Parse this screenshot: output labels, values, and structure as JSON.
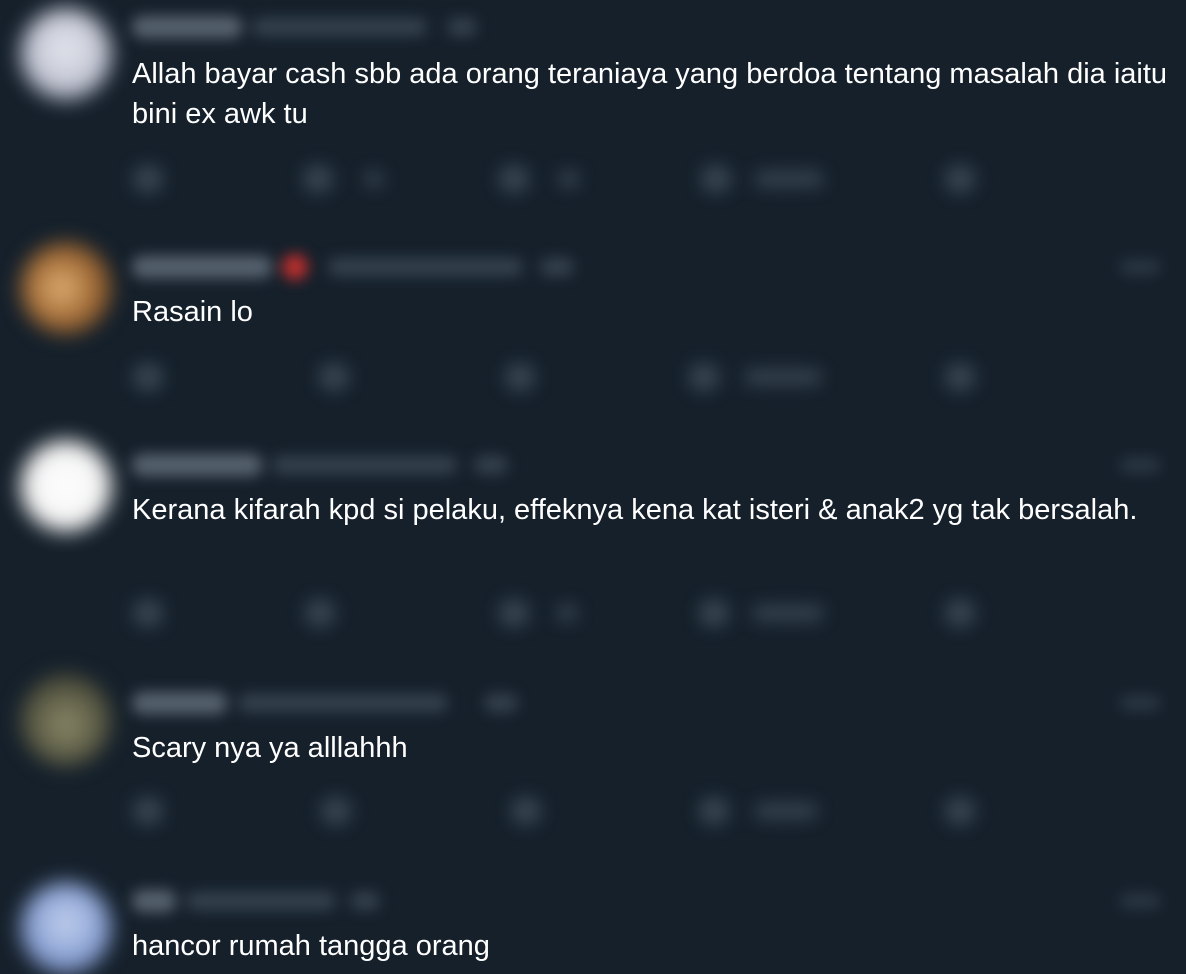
{
  "replies": [
    {
      "text": "Allah bayar cash sbb ada orang teraniaya yang berdoa tentang masalah dia iaitu bini ex awk tu",
      "avatar_color": "#c9ccd8"
    },
    {
      "text": "Rasain lo",
      "avatar_color": "#a8703a"
    },
    {
      "text": "Kerana kifarah kpd si pelaku, effeknya kena kat isteri & anak2 yg tak bersalah.",
      "avatar_color": "#f4f4f4"
    },
    {
      "text": "Scary nya ya alllahhh",
      "avatar_color": "#5b5b45"
    },
    {
      "text": "hancor rumah tangga orang",
      "avatar_color": "#8ea5d6"
    }
  ],
  "colors": {
    "background": "#15202b",
    "text": "#ffffff",
    "verified_badge": "#d0312d"
  }
}
